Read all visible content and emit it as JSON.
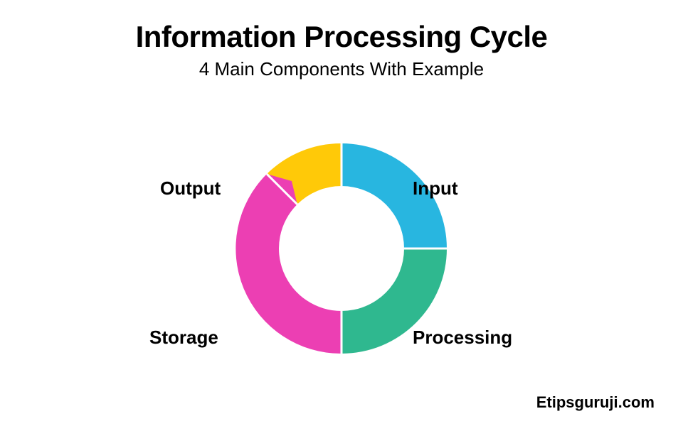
{
  "header": {
    "title": "Information Processing Cycle",
    "subtitle": "4 Main Components With Example"
  },
  "segments": {
    "input": {
      "label": "Input",
      "color": "#28b6e0"
    },
    "processing": {
      "label": "Processing",
      "color": "#2fb88f"
    },
    "storage": {
      "label": "Storage",
      "color": "#ec3fb3"
    },
    "output": {
      "label": "Output",
      "color": "#ffc908"
    }
  },
  "footer": {
    "credit": "Etipsguruji.com"
  }
}
